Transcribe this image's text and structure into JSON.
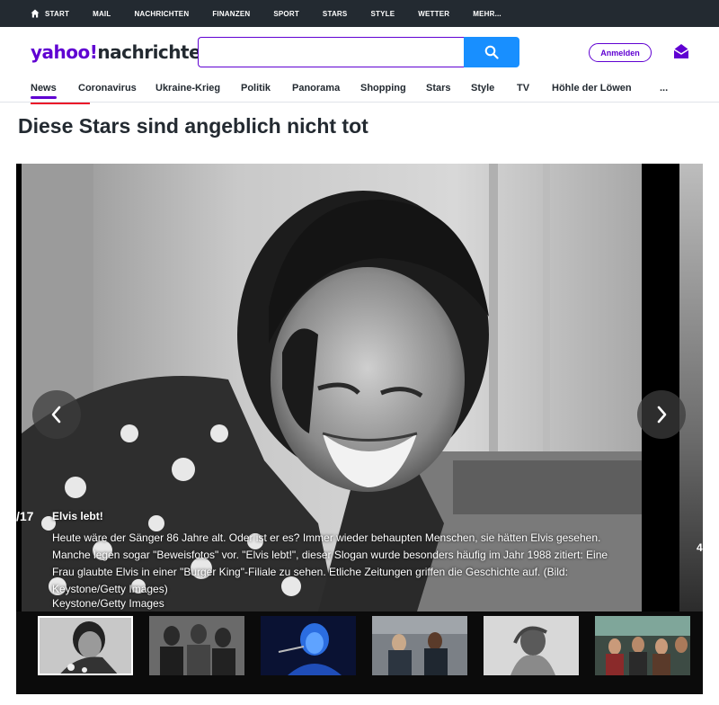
{
  "topnav": {
    "items": [
      "START",
      "MAIL",
      "NACHRICHTEN",
      "FINANZEN",
      "SPORT",
      "STARS",
      "STYLE",
      "WETTER",
      "MEHR..."
    ]
  },
  "header": {
    "logo_main": "yahoo!",
    "logo_sub": "nachrichten",
    "search_placeholder": "",
    "signin_label": "Anmelden"
  },
  "subnav": {
    "items": [
      "News",
      "Coronavirus",
      "Ukraine-Krieg",
      "Politik",
      "Panorama",
      "Shopping",
      "Stars",
      "Style",
      "TV",
      "Höhle der Löwen",
      "..."
    ],
    "active": "News"
  },
  "article": {
    "title": "Diese Stars sind angeblich nicht tot"
  },
  "slideshow": {
    "counter": "/17",
    "caption_title": "Elvis lebt!",
    "caption_text": "Heute wäre der Sänger 86 Jahre alt. Oder ist er es? Immer wieder behaupten Menschen, sie hätten Elvis gesehen. Manche legen sogar \"Beweisfotos\" vor. \"Elvis lebt!\", dieser Slogan wurde besonders häufig im Jahr 1988 zitiert: Eine Frau glaubte Elvis in einer \"Burger King\"-Filiale zu sehen. Etliche Zeitungen griffen die Geschichte auf. (Bild: Keystone/Getty Images)",
    "credit": "Keystone/Getty Images",
    "next_counter": "4",
    "thumbnail_count": 6
  },
  "colors": {
    "brand_purple": "#6001d2",
    "search_blue": "#188fff",
    "topbar_bg": "#232a31",
    "accent_red": "#eb0f29"
  }
}
